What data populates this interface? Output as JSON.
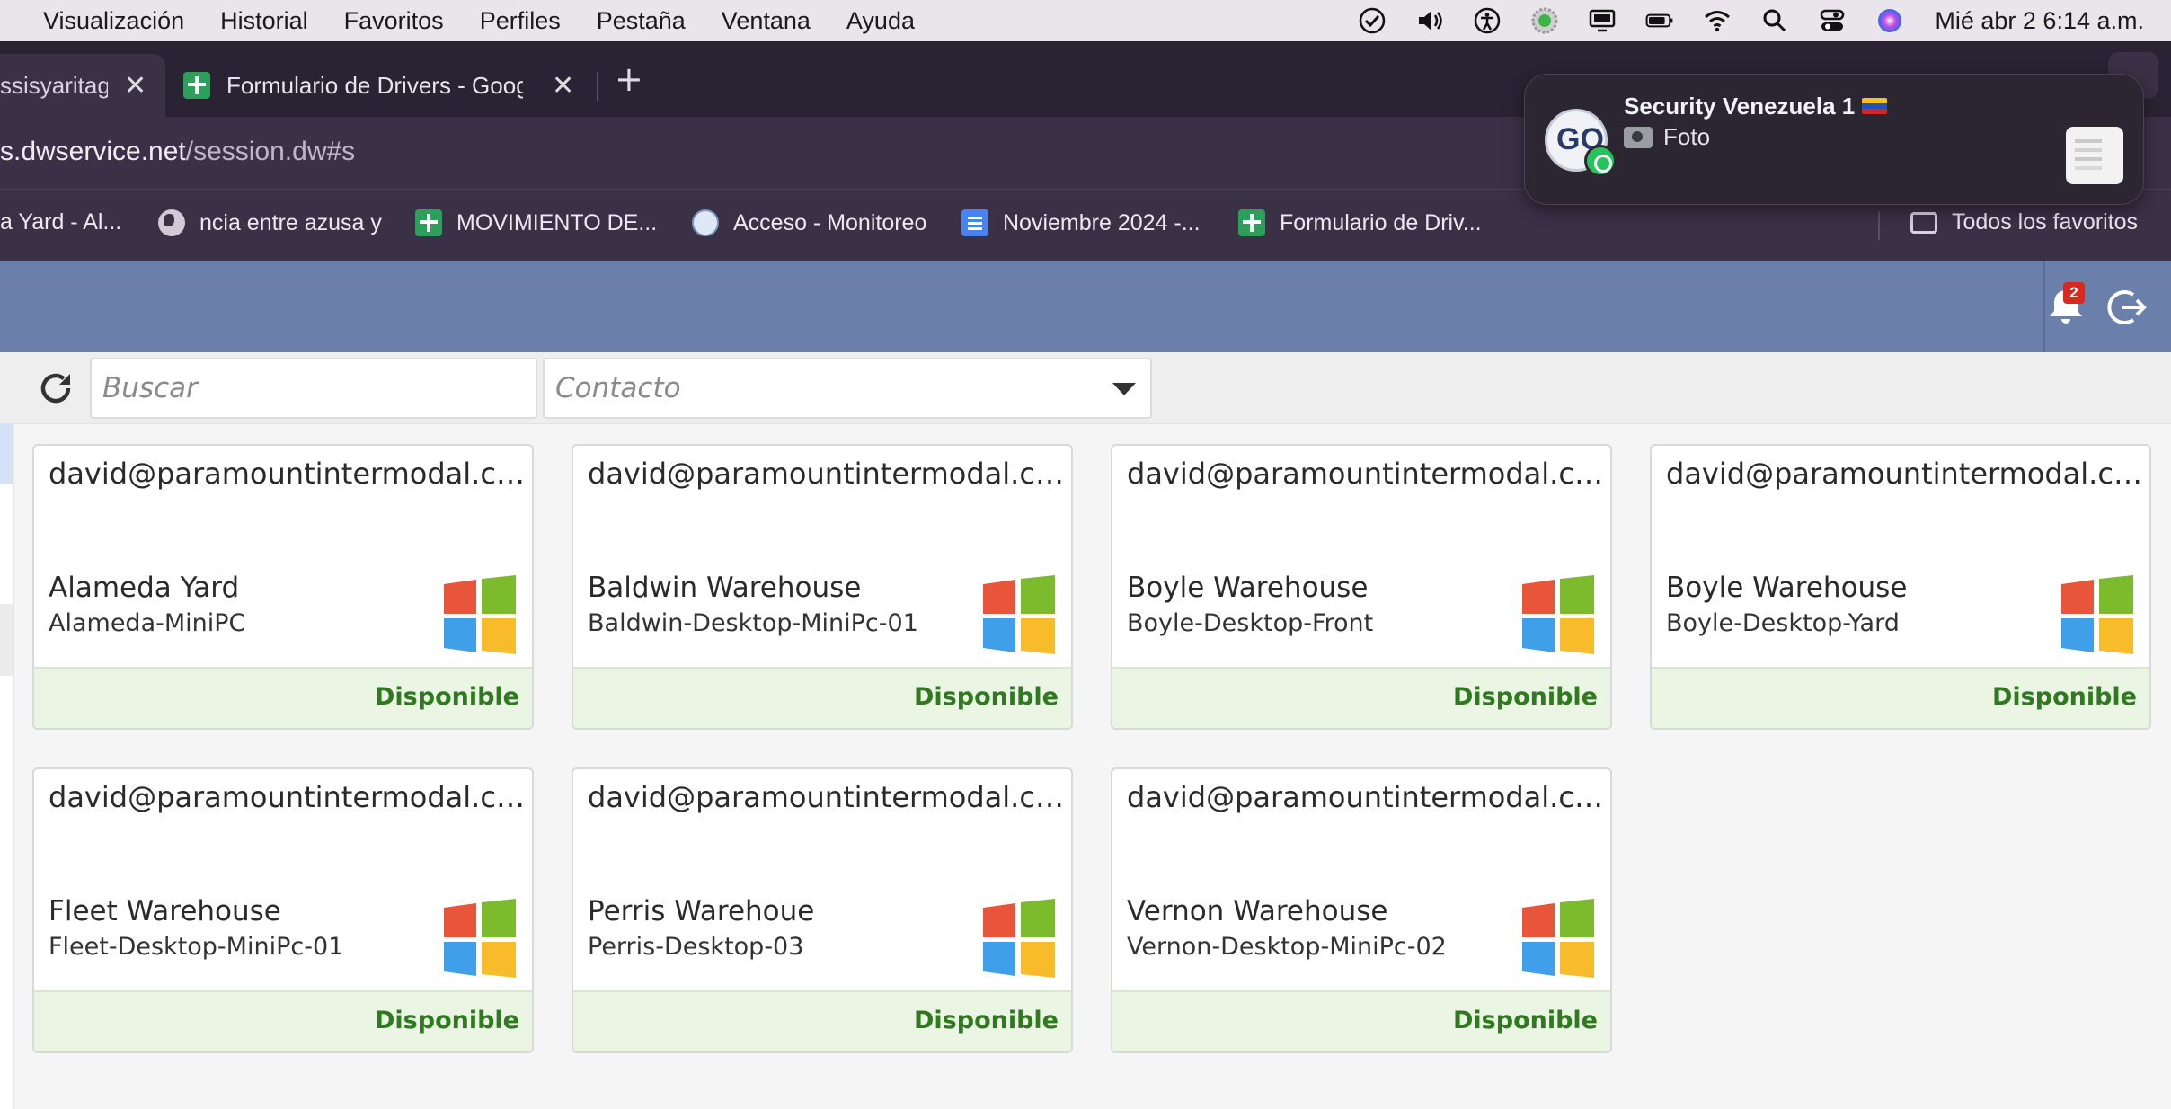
{
  "menubar": {
    "menus": [
      "Visualización",
      "Historial",
      "Favoritos",
      "Perfiles",
      "Pestaña",
      "Ventana",
      "Ayuda"
    ],
    "clock": "Mié abr 2  6:14 a.m."
  },
  "tabs": [
    {
      "label": "ssisyaritag"
    },
    {
      "label": "Formulario de Drivers - Google"
    }
  ],
  "address": {
    "host": "s.dwservice.net",
    "path": "/session.dw#s"
  },
  "bookmarks": [
    {
      "label": "a Yard - Al..."
    },
    {
      "label": "ncia entre azusa y"
    },
    {
      "label": "MOVIMIENTO DE..."
    },
    {
      "label": "Acceso - Monitoreo"
    },
    {
      "label": "Noviembre 2024 -..."
    },
    {
      "label": "Formulario de Driv..."
    },
    {
      "label": "Todos los favoritos"
    }
  ],
  "header": {
    "notification_count": "2"
  },
  "toolbar": {
    "search_placeholder": "Buscar",
    "contact_placeholder": "Contacto"
  },
  "agents": [
    {
      "user": "david@paramountintermodal.com",
      "name": "Alameda Yard",
      "host": "Alameda-MiniPC",
      "status": "Disponible"
    },
    {
      "user": "david@paramountintermodal.com",
      "name": "Baldwin Warehouse",
      "host": "Baldwin-Desktop-MiniPc-01",
      "status": "Disponible"
    },
    {
      "user": "david@paramountintermodal.com",
      "name": "Boyle Warehouse",
      "host": "Boyle-Desktop-Front",
      "status": "Disponible"
    },
    {
      "user": "david@paramountintermodal.com",
      "name": "Boyle Warehouse",
      "host": "Boyle-Desktop-Yard",
      "status": "Disponible"
    },
    {
      "user": "david@paramountintermodal.com",
      "name": "Fleet Warehouse",
      "host": "Fleet-Desktop-MiniPc-01",
      "status": "Disponible"
    },
    {
      "user": "david@paramountintermodal.com",
      "name": "Perris Warehoue",
      "host": "Perris-Desktop-03",
      "status": "Disponible"
    },
    {
      "user": "david@paramountintermodal.com",
      "name": "Vernon Warehouse",
      "host": "Vernon-Desktop-MiniPc-02",
      "status": "Disponible"
    }
  ],
  "notification": {
    "title": "Security Venezuela 1",
    "body": "Foto",
    "avatar_text": "GO"
  },
  "colors": {
    "header": "#6a7fa9",
    "status_ok": "#2f7a1f",
    "win_red": "#e8553a",
    "win_green": "#7cbc2c",
    "win_blue": "#3f9fe8",
    "win_yellow": "#f8bb2a"
  }
}
